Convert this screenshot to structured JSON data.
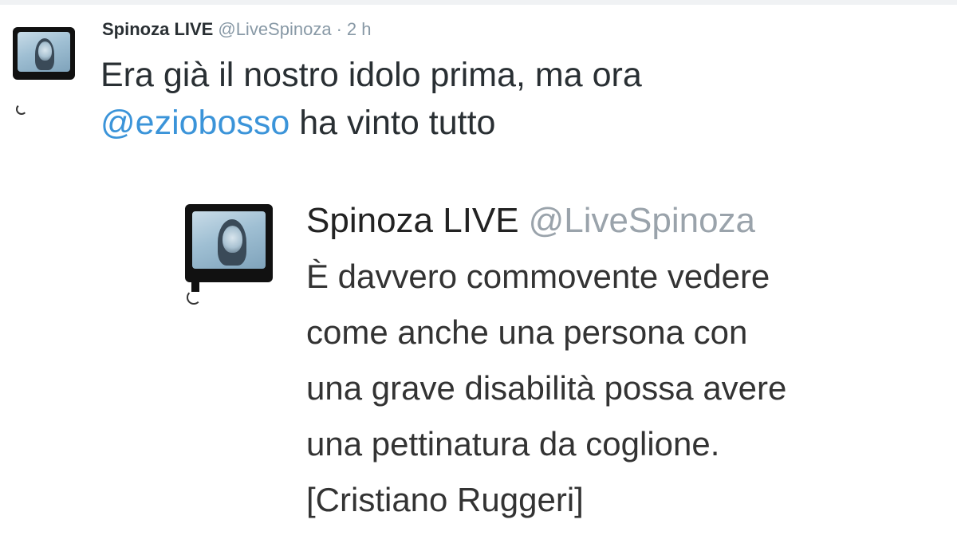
{
  "tweet": {
    "author_name": "Spinoza LIVE",
    "author_handle": "@LiveSpinoza",
    "separator": "·",
    "time": "2 h",
    "text_before": "Era già il nostro idolo prima, ma ora",
    "mention": "@eziobosso",
    "text_after": " ha vinto tutto",
    "avatar_icon": "tv-portrait-avatar"
  },
  "quoted": {
    "author_name": "Spinoza LIVE",
    "author_handle": "@LiveSpinoza",
    "text": "È davvero commovente vedere come anche una persona con una grave disabilità possa avere una pettinatura da coglione. [Cristiano Ruggeri]",
    "avatar_icon": "tv-portrait-avatar"
  },
  "colors": {
    "mention": "#3b94d9",
    "muted": "#8899a6",
    "text": "#292f33"
  }
}
